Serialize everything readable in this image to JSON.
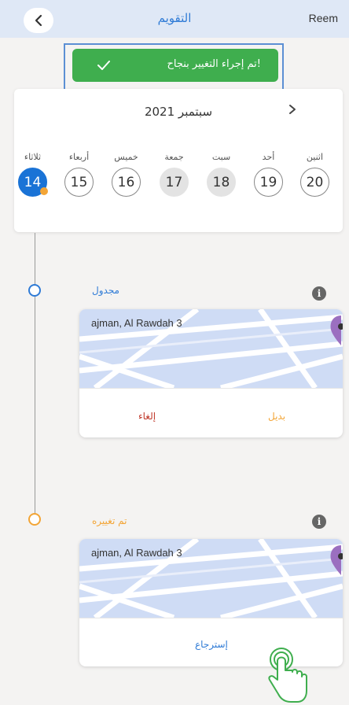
{
  "header": {
    "title": "التقويم",
    "user": "Reem"
  },
  "toast": {
    "text": "!تم إجراء التغيير بنجاح"
  },
  "calendar": {
    "month": "سبتمبر 2021",
    "days": [
      {
        "name": "ثلاثاء",
        "num": "14"
      },
      {
        "name": "أربعاء",
        "num": "15"
      },
      {
        "name": "خميس",
        "num": "16"
      },
      {
        "name": "جمعة",
        "num": "17"
      },
      {
        "name": "سبت",
        "num": "18"
      },
      {
        "name": "أحد",
        "num": "19"
      },
      {
        "name": "اثنين",
        "num": "20"
      }
    ]
  },
  "events": [
    {
      "status": "مجدول",
      "address": "ajman, Al Rawdah 3",
      "cancel_label": "إلغاء",
      "replace_label": "بديل"
    },
    {
      "status": "تم تغييره",
      "address": "ajman, Al Rawdah 3",
      "restore_label": "إسترجاع"
    }
  ],
  "colors": {
    "accent": "#2f7bd6",
    "success": "#3fae4e",
    "changed": "#f3a536",
    "cancel": "#c0392b",
    "header_bg": "#dfe8f6"
  }
}
